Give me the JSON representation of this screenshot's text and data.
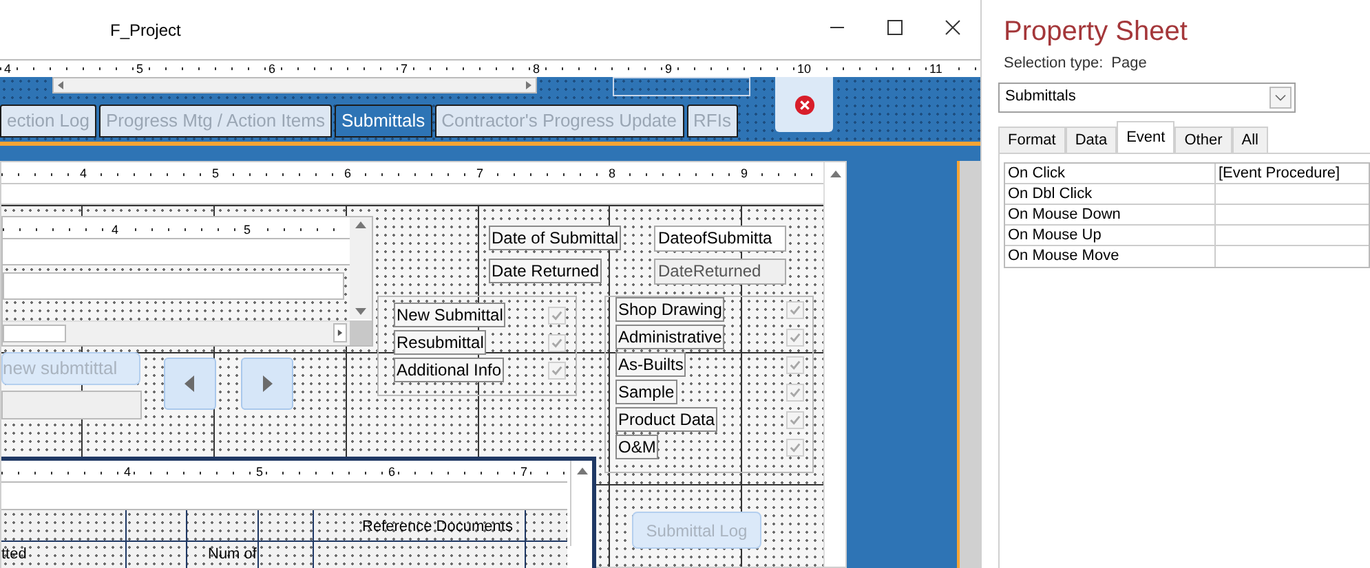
{
  "window": {
    "title": "F_Project"
  },
  "ruler": {
    "labels": [
      "4",
      "5",
      "6",
      "7",
      "8",
      "9",
      "10",
      "11"
    ]
  },
  "form_tabs": [
    {
      "label": "ection Log",
      "selected": false
    },
    {
      "label": "Progress Mtg / Action Items",
      "selected": false
    },
    {
      "label": "Submittals",
      "selected": true
    },
    {
      "label": "Contractor's Progress Update",
      "selected": false
    },
    {
      "label": "RFIs",
      "selected": false
    }
  ],
  "subform": {
    "ruler_labels": [
      "4",
      "5",
      "6",
      "7",
      "8",
      "9"
    ],
    "nested_ruler_labels": [
      "4",
      "5"
    ],
    "new_button": "new submtittal",
    "status_options": [
      {
        "label": "New Submittal",
        "checked": true
      },
      {
        "label": "Resubmittal",
        "checked": true
      },
      {
        "label": "Additional Info",
        "checked": true
      }
    ],
    "date_fields": [
      {
        "label": "Date of Submittal",
        "value": "DateofSubmitta",
        "disabled": false
      },
      {
        "label": "Date Returned",
        "value": "DateReturned",
        "disabled": true
      }
    ],
    "type_options": [
      {
        "label": "Shop Drawing",
        "checked": true
      },
      {
        "label": "Administrative",
        "checked": true
      },
      {
        "label": "As-Builts",
        "checked": true
      },
      {
        "label": "Sample",
        "checked": true
      },
      {
        "label": "Product Data",
        "checked": true
      },
      {
        "label": "O&M",
        "checked": true
      }
    ],
    "lower_ruler_labels": [
      "4",
      "5",
      "6",
      "7"
    ],
    "lower_headers": [
      "tted",
      "Num of",
      "Reference Documents"
    ],
    "log_button": "Submittal Log"
  },
  "property_sheet": {
    "title": "Property Sheet",
    "selection_type_label": "Selection type:",
    "selection_type": "Page",
    "object": "Submittals",
    "tabs": [
      {
        "label": "Format",
        "selected": false
      },
      {
        "label": "Data",
        "selected": false
      },
      {
        "label": "Event",
        "selected": true
      },
      {
        "label": "Other",
        "selected": false
      },
      {
        "label": "All",
        "selected": false
      }
    ],
    "properties": [
      {
        "name": "On Click",
        "value": "[Event Procedure]"
      },
      {
        "name": "On Dbl Click"
      },
      {
        "name": "On Mouse Down"
      },
      {
        "name": "On Mouse Up"
      },
      {
        "name": "On Mouse Move"
      }
    ]
  }
}
